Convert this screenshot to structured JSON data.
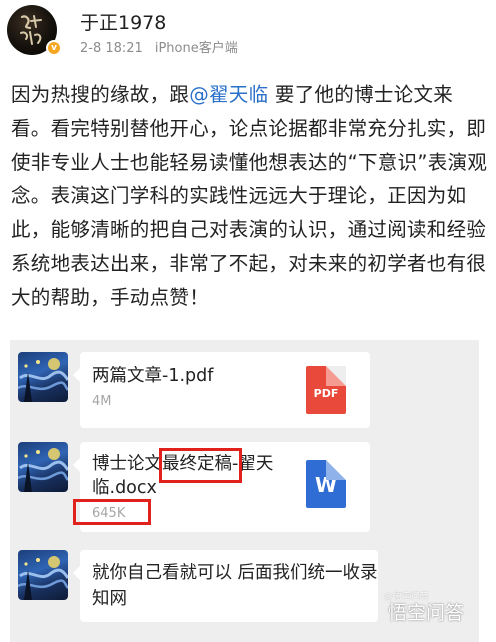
{
  "post": {
    "username": "于正1978",
    "timestamp": "2-8 18:21",
    "source": "iPhone客户端",
    "body_before": "因为热搜的缘故，跟",
    "mention": "@翟天临",
    "body_after": " 要了他的博士论文来看。看完特别替他开心，论点论据都非常充分扎实，即使非专业人士也能轻易读懂他想表达的“下意识”表演观念。表演这门学科的实践性远远大于理论，正因为如此，能够清晰的把自己对表演的认识，通过阅读和经验系统地表达出来，非常了不起，对未来的初学者也有很大的帮助，手动点赞！",
    "verified_badge": "v",
    "avatar_icon": "calligraphy-avatar-icon"
  },
  "chat": {
    "messages": [
      {
        "type": "file",
        "file_name": "两篇文章-1.pdf",
        "file_size": "4M",
        "file_icon": "pdf-file-icon",
        "icon_label": "PDF"
      },
      {
        "type": "file",
        "file_name_line1": "博士论文最终定稿-翟天",
        "file_name_line2": "临.docx",
        "file_size": "645K",
        "file_icon": "word-file-icon",
        "icon_label": "W"
      },
      {
        "type": "text",
        "text": "就你自己看就可以 后面我们统一收录知网"
      }
    ],
    "highlight_color": "#e0211c",
    "avatar_icon": "starry-night-avatar-icon"
  },
  "watermark": {
    "main": "悟空问答",
    "sub": "@悟空问答"
  },
  "colors": {
    "mention": "#2a6fc9",
    "meta_text": "#8c8c8c",
    "chat_background": "#eeeeee",
    "pdf_red": "#e9493b",
    "word_blue": "#2f6cd3",
    "verified_orange": "#f5a623"
  }
}
